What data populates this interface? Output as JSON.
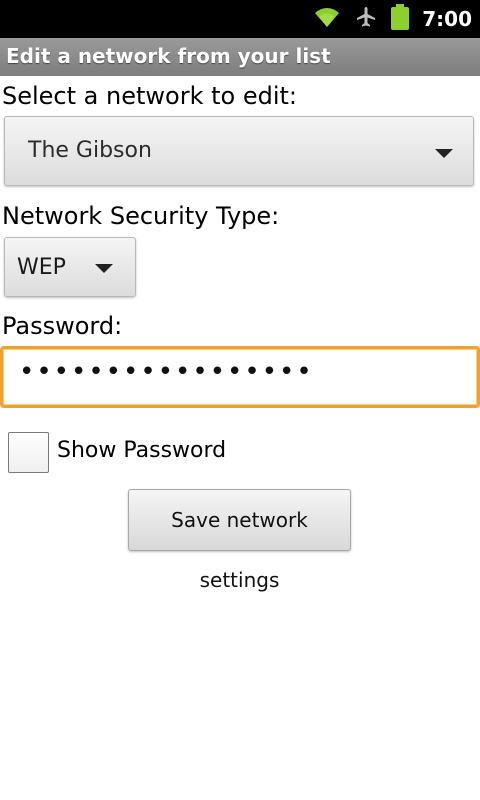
{
  "status_bar": {
    "time": "7:00",
    "icons": [
      "wifi-icon",
      "airplane-icon",
      "battery-icon"
    ],
    "colors": {
      "wifi": "#8ccf2e",
      "battery": "#8ccf2e",
      "airplane": "#bdbdbd"
    }
  },
  "title_bar": {
    "title": "Edit a network from your list"
  },
  "form": {
    "network_label": "Select a network to edit:",
    "network_selected": "The Gibson",
    "security_label": "Network Security Type:",
    "security_selected": "WEP",
    "password_label": "Password:",
    "password_masked": "•••••••••••••••••",
    "show_password_label": "Show Password",
    "show_password_checked": false,
    "save_button_label": "Save network settings"
  },
  "theme": {
    "focus_border": "#f0a030",
    "title_bar_bg": "#8a8a8a"
  }
}
